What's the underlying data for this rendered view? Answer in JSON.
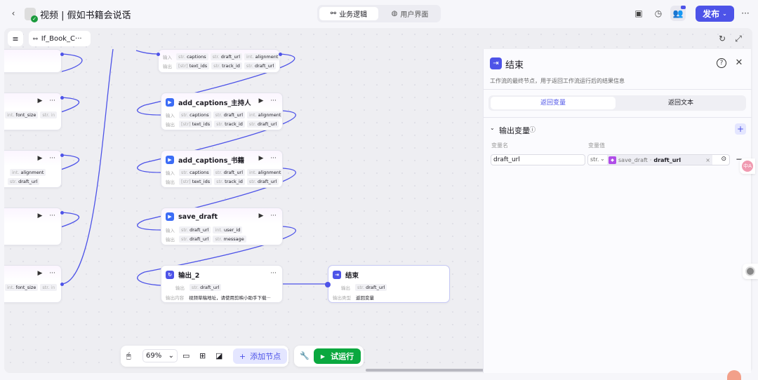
{
  "header": {
    "title": "视频 | 假如书籍会说话",
    "tabs": [
      {
        "label": "业务逻辑",
        "active": true
      },
      {
        "label": "用户界面",
        "active": false
      }
    ],
    "publish": "发布"
  },
  "canvas": {
    "workflow_name": "If_Book_C···"
  },
  "nodes": {
    "top_mid": {
      "in": "输入",
      "out": "输出",
      "in_tags": [
        [
          "str.",
          "captions"
        ],
        [
          "str.",
          "draft_url"
        ],
        [
          "int.",
          "alignment"
        ]
      ],
      "out_tags": [
        [
          "[str]",
          "text_ids"
        ],
        [
          "str.",
          "track_id"
        ],
        [
          "str.",
          "draft_url"
        ]
      ]
    },
    "host": {
      "title": "add_captions_主持人",
      "in": "输入",
      "out": "输出",
      "in_tags": [
        [
          "str.",
          "captions"
        ],
        [
          "str.",
          "draft_url"
        ],
        [
          "int.",
          "alignment"
        ]
      ],
      "out_tags": [
        [
          "[str]",
          "text_ids"
        ],
        [
          "str.",
          "track_id"
        ],
        [
          "str.",
          "draft_url"
        ]
      ]
    },
    "book": {
      "title": "add_captions_书籍",
      "in": "输入",
      "out": "输出",
      "in_tags": [
        [
          "str.",
          "captions"
        ],
        [
          "str.",
          "draft_url"
        ],
        [
          "int.",
          "alignment"
        ]
      ],
      "out_tags": [
        [
          "[str]",
          "text_ids"
        ],
        [
          "str.",
          "track_id"
        ],
        [
          "str.",
          "draft_url"
        ]
      ]
    },
    "save": {
      "title": "save_draft",
      "in": "输入",
      "out": "输出",
      "in_tags": [
        [
          "str.",
          "draft_url"
        ],
        [
          "int.",
          "user_id"
        ]
      ],
      "out_tags": [
        [
          "str.",
          "draft_url"
        ],
        [
          "str.",
          "message"
        ]
      ]
    },
    "out2": {
      "title": "输出_2",
      "out_label": "输出",
      "out_tag": [
        "str.",
        "draft_url"
      ],
      "content_label": "输出内容",
      "content": "视频草稿地址，请使用剪映小助手下载···"
    },
    "end": {
      "title": "结束",
      "out_label": "输出",
      "out_tag": [
        "str.",
        "draft_url"
      ],
      "type_label": "输出类型",
      "type": "返回变量"
    },
    "left": [
      {
        "tags": [
          [
            "int.",
            "font_size"
          ],
          [
            "str.",
            "in"
          ]
        ]
      },
      {
        "tags": [
          [
            "int.",
            "alignment"
          ]
        ],
        "tags2": [
          [
            "str.",
            "draft_url"
          ]
        ]
      },
      {
        "tags": []
      },
      {
        "tags": [
          [
            "int.",
            "font_size"
          ],
          [
            "str.",
            "in"
          ]
        ]
      }
    ]
  },
  "toolbar": {
    "zoom": "69%",
    "add_node": "添加节点",
    "run": "试运行"
  },
  "panel": {
    "title": "结束",
    "desc": "工作流的最终节点，用于返回工作流运行后的结果信息",
    "tabs": [
      "返回变量",
      "返回文本"
    ],
    "section": "输出变量",
    "col_name": "变量名",
    "col_value": "变量值",
    "var_name": "draft_url",
    "var_type": "str.",
    "ref_node": "save_draft",
    "ref_var": "draft_url"
  },
  "colors": {
    "accent": "#4d53e8",
    "run": "#0aa83f"
  }
}
